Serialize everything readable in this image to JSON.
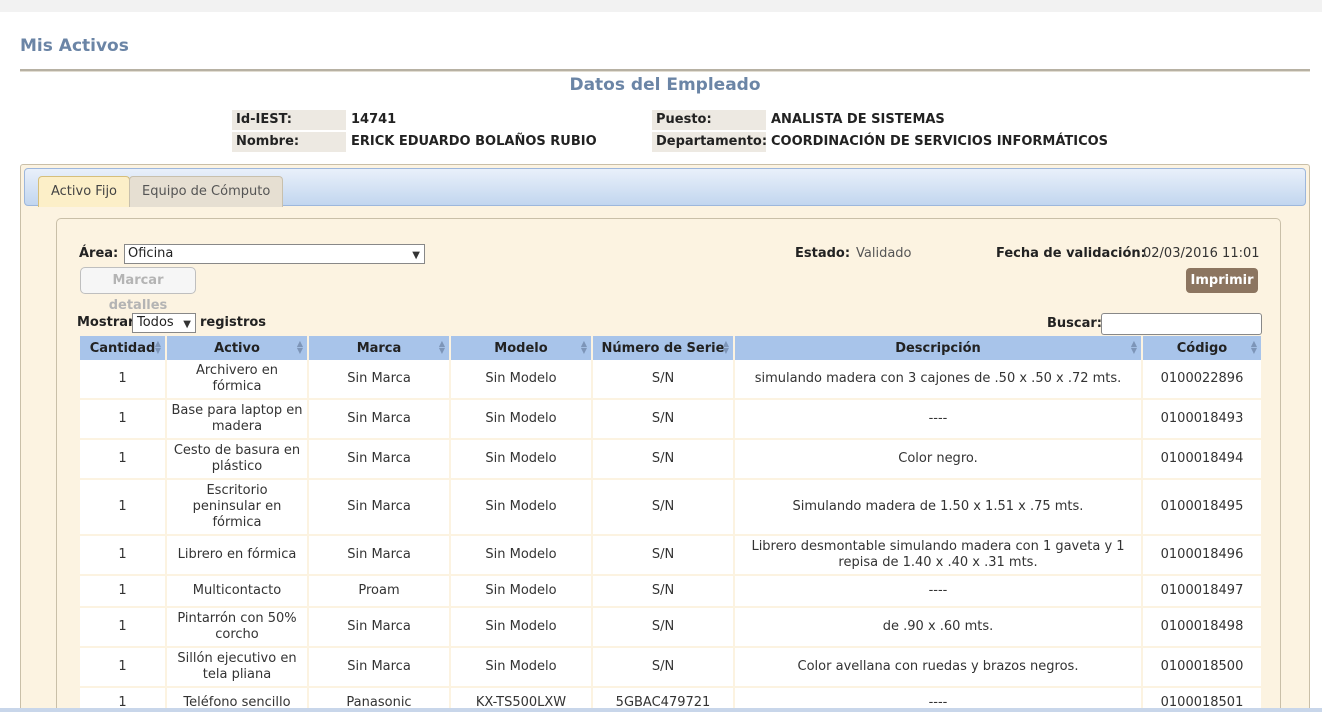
{
  "page_title": "Mis Activos",
  "section_title": "Datos del Empleado",
  "employee": {
    "id_label": "Id-IEST:",
    "id_value": "14741",
    "name_label": "Nombre:",
    "name_value": "ERICK EDUARDO BOLAÑOS RUBIO",
    "position_label": "Puesto:",
    "position_value": "ANALISTA DE SISTEMAS",
    "dept_label": "Departamento:",
    "dept_value": "COORDINACIÓN DE SERVICIOS INFORMÁTICOS"
  },
  "tabs": [
    {
      "label": "Activo Fijo",
      "active": true
    },
    {
      "label": "Equipo de Cómputo",
      "active": false
    }
  ],
  "filters": {
    "area_label": "Área:",
    "area_value": "Oficina",
    "status_label": "Estado:",
    "status_value": "Validado",
    "validation_label": "Fecha de validación:",
    "validation_value": "02/03/2016 11:01",
    "mark_details_label": "Marcar detalles",
    "print_label": "Imprimir"
  },
  "table_controls": {
    "show_label": "Mostrar",
    "show_value": "Todos",
    "records_label": "registros",
    "search_label": "Buscar:",
    "search_value": ""
  },
  "columns": [
    "Cantidad",
    "Activo",
    "Marca",
    "Modelo",
    "Número de Serie",
    "Descripción",
    "Código"
  ],
  "rows": [
    [
      "1",
      "Archivero en fórmica",
      "Sin Marca",
      "Sin Modelo",
      "S/N",
      "simulando madera con 3 cajones de .50 x .50 x .72 mts.",
      "0100022896"
    ],
    [
      "1",
      "Base para laptop en madera",
      "Sin Marca",
      "Sin Modelo",
      "S/N",
      "----",
      "0100018493"
    ],
    [
      "1",
      "Cesto de basura en plástico",
      "Sin Marca",
      "Sin Modelo",
      "S/N",
      "Color negro.",
      "0100018494"
    ],
    [
      "1",
      "Escritorio peninsular en fórmica",
      "Sin Marca",
      "Sin Modelo",
      "S/N",
      "Simulando madera de 1.50 x 1.51 x .75 mts.",
      "0100018495"
    ],
    [
      "1",
      "Librero en fórmica",
      "Sin Marca",
      "Sin Modelo",
      "S/N",
      "Librero desmontable simulando madera con 1 gaveta y 1 repisa de 1.40 x .40 x .31 mts.",
      "0100018496"
    ],
    [
      "1",
      "Multicontacto",
      "Proam",
      "Sin Modelo",
      "S/N",
      "----",
      "0100018497"
    ],
    [
      "1",
      "Pintarrón con 50% corcho",
      "Sin Marca",
      "Sin Modelo",
      "S/N",
      "de .90 x .60 mts.",
      "0100018498"
    ],
    [
      "1",
      "Sillón ejecutivo en tela pliana",
      "Sin Marca",
      "Sin Modelo",
      "S/N",
      "Color avellana con ruedas y brazos negros.",
      "0100018500"
    ],
    [
      "1",
      "Teléfono sencillo",
      "Panasonic",
      "KX-TS500LXW",
      "5GBAC479721",
      "----",
      "0100018501"
    ]
  ]
}
